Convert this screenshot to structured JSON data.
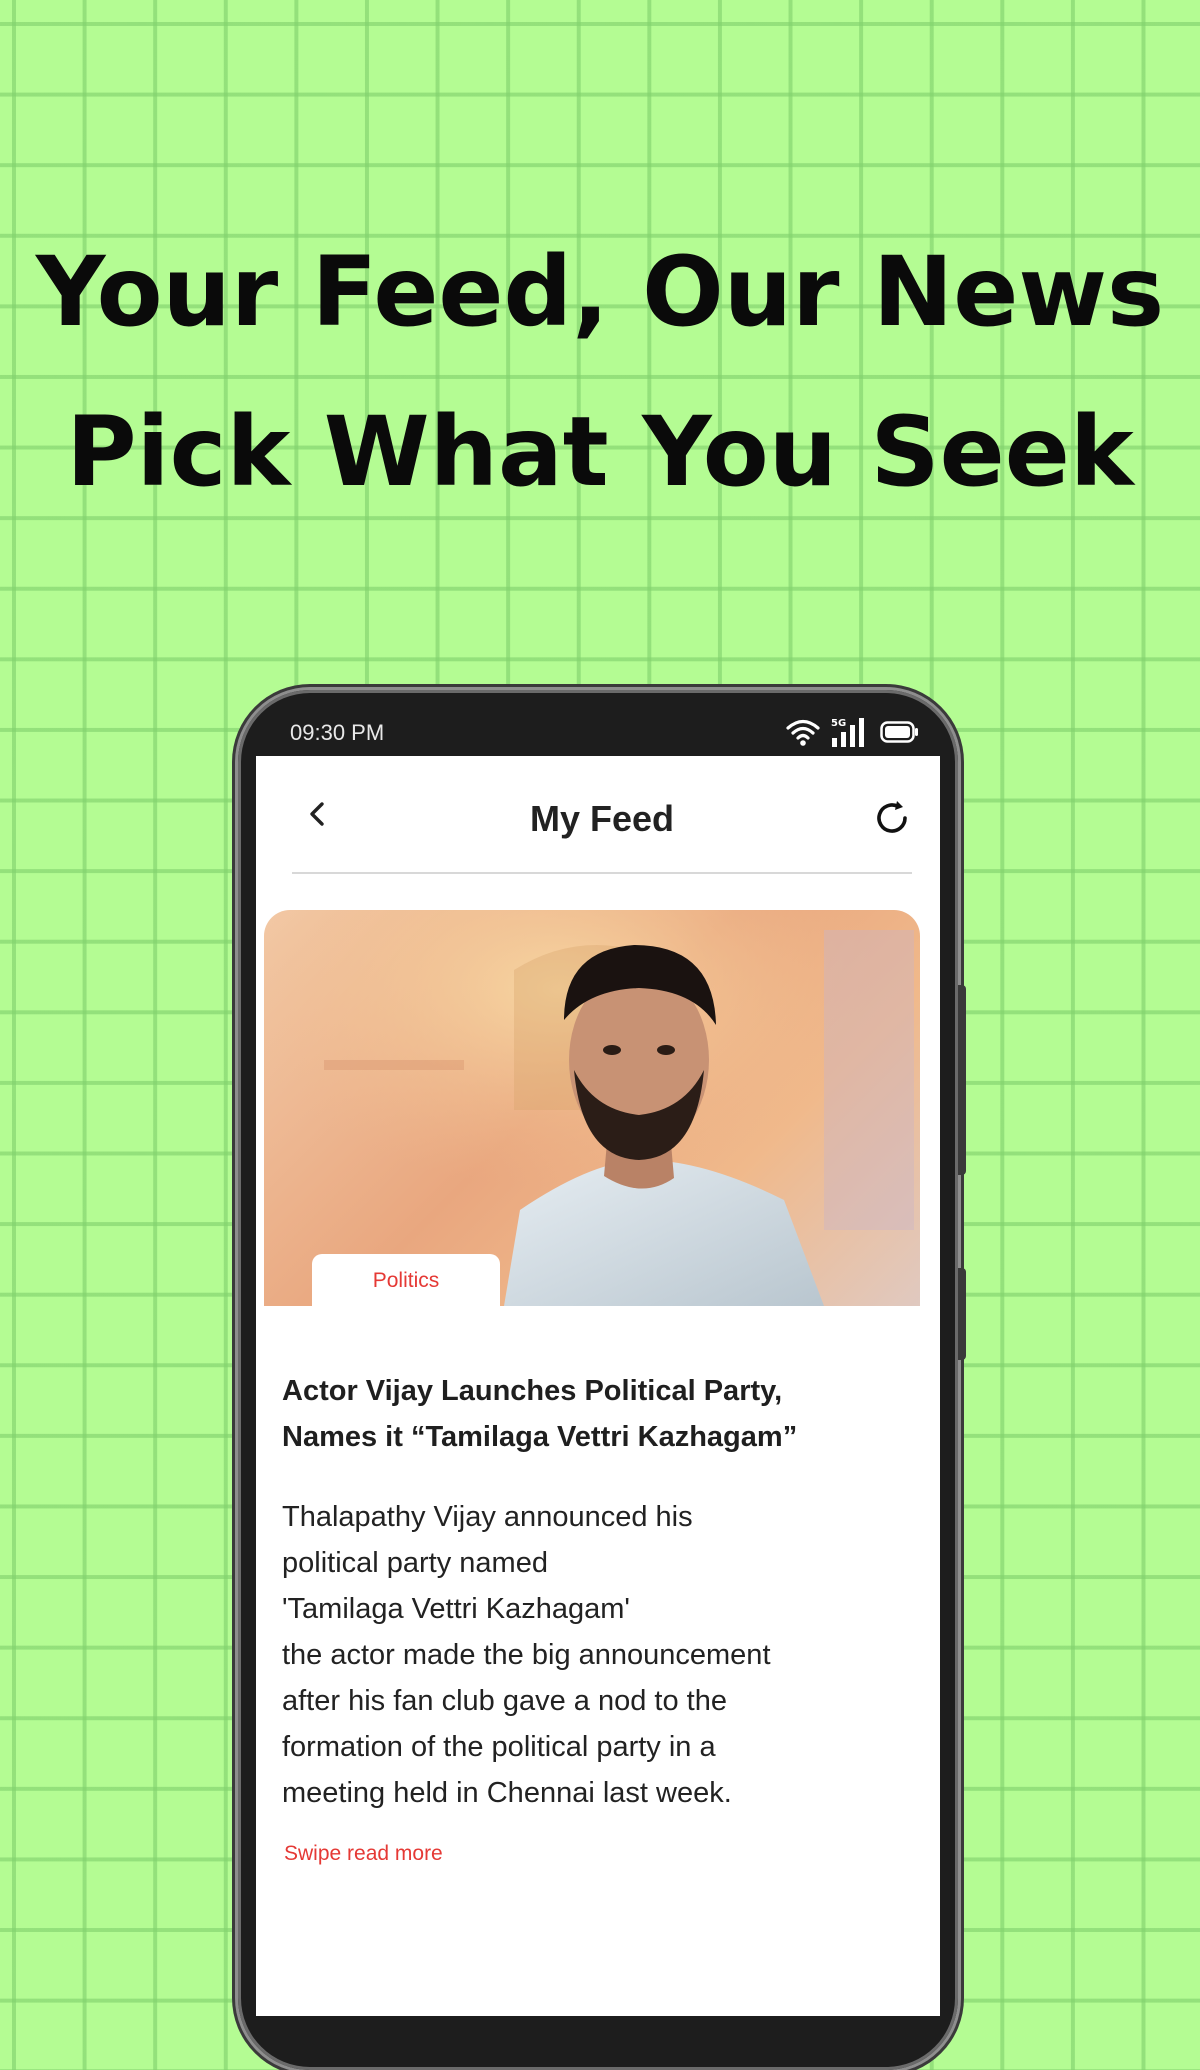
{
  "promo": {
    "headline_line1": "Your Feed, Our News",
    "headline_line2": "Pick What You Seek",
    "background_color": "#b4fc93"
  },
  "status_bar": {
    "time": "09:30 PM",
    "network_label": "5G",
    "icons": [
      "wifi-icon",
      "cellular-signal-icon",
      "battery-icon"
    ]
  },
  "app_header": {
    "title": "My Feed",
    "back_icon": "chevron-left-icon",
    "refresh_icon": "refresh-icon"
  },
  "article": {
    "category": "Politics",
    "title_lines": [
      "Actor Vijay Launches Political Party,",
      "Names it “Tamilaga Vettri Kazhagam”"
    ],
    "body_lines": [
      "Thalapathy Vijay announced his",
      "political party named",
      "'Tamilaga Vettri Kazhagam'",
      "the actor made the big announcement",
      "after his fan club gave a nod to the",
      "formation of the political party in a",
      "meeting held in Chennai last week."
    ],
    "read_more": "Swipe read more"
  },
  "colors": {
    "accent": "#e53935",
    "title_text": "#1f1f1f",
    "phone_frame": "#1d1d1d"
  }
}
